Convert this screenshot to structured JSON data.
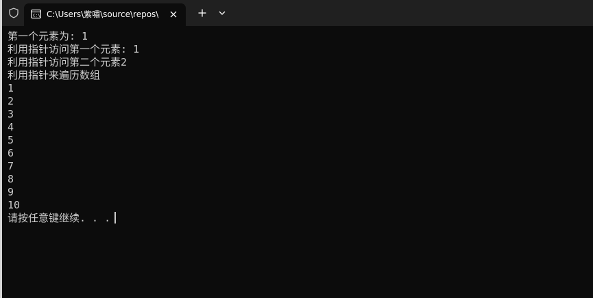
{
  "tab": {
    "title": "C:\\Users\\紫嘯\\source\\repos\\看"
  },
  "console": {
    "lines": [
      "第一个元素为: 1",
      "利用指针访问第一个元素: 1",
      "利用指针访问第二个元素2",
      "利用指针来遍历数组",
      "1",
      "2",
      "3",
      "4",
      "5",
      "6",
      "7",
      "8",
      "9",
      "10"
    ],
    "prompt": "请按任意键继续. . ."
  },
  "icons": {
    "shield": "shield-icon",
    "terminal": "terminal-icon",
    "close": "close-icon",
    "new_tab": "plus-icon",
    "dropdown": "chevron-down-icon"
  },
  "colors": {
    "background": "#0c0c0c",
    "titlebar": "#202020",
    "text": "#cccccc"
  }
}
